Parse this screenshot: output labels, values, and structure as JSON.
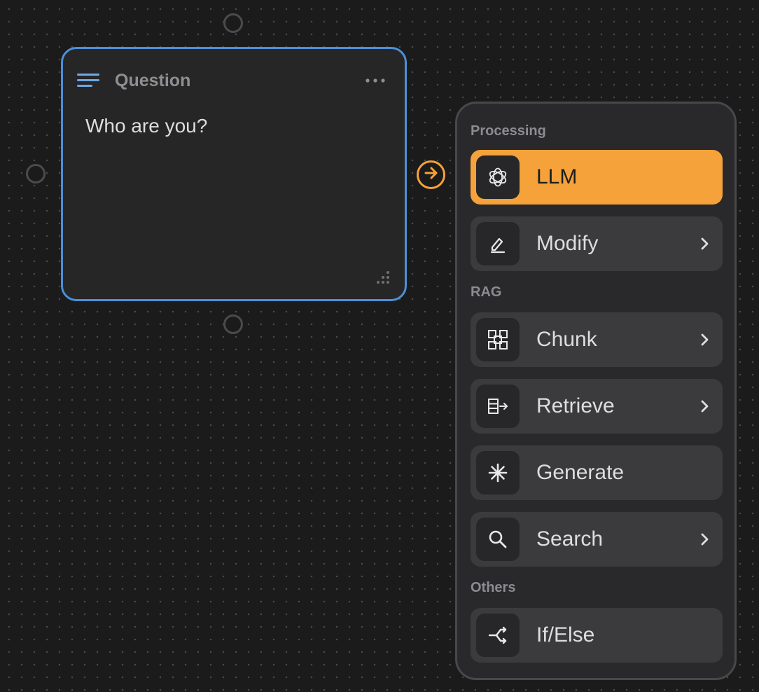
{
  "node": {
    "title": "Question",
    "content": "Who are you?"
  },
  "panel": {
    "sections": [
      {
        "label": "Processing",
        "items": [
          {
            "label": "LLM",
            "icon": "openai-icon",
            "active": true,
            "has_submenu": false
          },
          {
            "label": "Modify",
            "icon": "pencil-icon",
            "active": false,
            "has_submenu": true
          }
        ]
      },
      {
        "label": "RAG",
        "items": [
          {
            "label": "Chunk",
            "icon": "chunk-grid-icon",
            "active": false,
            "has_submenu": true
          },
          {
            "label": "Retrieve",
            "icon": "retrieve-icon",
            "active": false,
            "has_submenu": true
          },
          {
            "label": "Generate",
            "icon": "asterisk-icon",
            "active": false,
            "has_submenu": false
          },
          {
            "label": "Search",
            "icon": "search-icon",
            "active": false,
            "has_submenu": true
          }
        ]
      },
      {
        "label": "Others",
        "items": [
          {
            "label": "If/Else",
            "icon": "branch-icon",
            "active": false,
            "has_submenu": false
          }
        ]
      }
    ]
  },
  "colors": {
    "canvas": "#1b1b1c",
    "node_border": "#4a90d9",
    "accent": "#f5a23a",
    "panel_bg": "#29292b",
    "item_bg": "#3b3b3e"
  }
}
